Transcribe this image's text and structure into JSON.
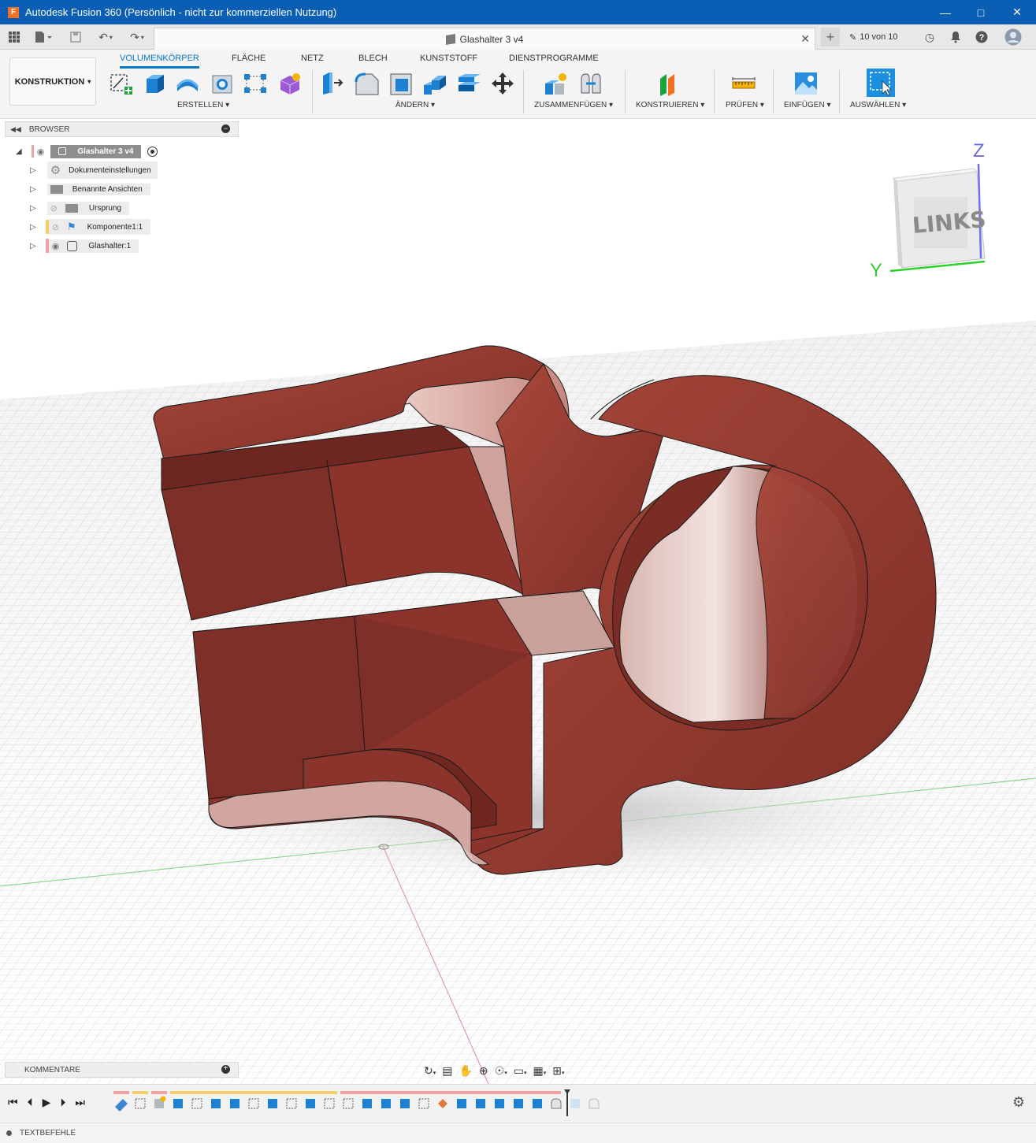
{
  "window": {
    "title": "Autodesk Fusion 360 (Persönlich - nicht zur kommerziellen Nutzung)",
    "app_logo": "F"
  },
  "document_tab": {
    "title": "Glashalter 3 v4",
    "version_count": "10 von 10"
  },
  "toolbar": {
    "workspace": "KONSTRUKTION",
    "tabs": [
      "VOLUMENKÖRPER",
      "FLÄCHE",
      "NETZ",
      "BLECH",
      "KUNSTSTOFF",
      "DIENSTPROGRAMME"
    ],
    "active_tab": "VOLUMENKÖRPER",
    "groups": [
      "ERSTELLEN",
      "ÄNDERN",
      "ZUSAMMENFÜGEN",
      "KONSTRUIEREN",
      "PRÜFEN",
      "EINFÜGEN",
      "AUSWÄHLEN"
    ]
  },
  "browser": {
    "header": "BROWSER",
    "root": "Glashalter 3 v4",
    "items": [
      {
        "label": "Dokumenteinstellungen",
        "icon": "gear-icon"
      },
      {
        "label": "Benannte Ansichten",
        "icon": "folder-icon"
      },
      {
        "label": "Ursprung",
        "icon": "folder-icon"
      },
      {
        "label": "Komponente1:1",
        "icon": "component-icon"
      },
      {
        "label": "Glashalter:1",
        "icon": "body-icon"
      }
    ]
  },
  "viewcube": {
    "face": "LINKS",
    "axis_z": "Z",
    "axis_y": "Y"
  },
  "comments": {
    "label": "KOMMENTARE"
  },
  "footer": {
    "text_commands": "TEXTBEFEHLE"
  },
  "colors": {
    "titlebar": "#0a5fb4",
    "accent": "#0a77c8",
    "model": "#9b3a2e"
  }
}
